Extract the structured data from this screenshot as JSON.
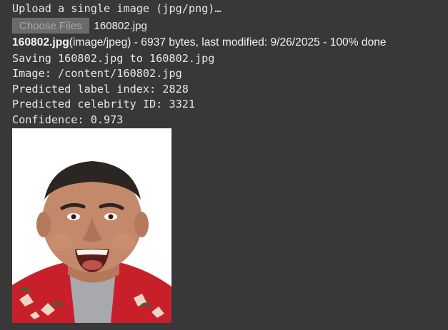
{
  "prompt": "Upload a single image (jpg/png)…",
  "upload": {
    "button_label": "Choose Files",
    "selected_file": "160802.jpg"
  },
  "file_info": {
    "name": "160802.jpg",
    "details": "(image/jpeg) - 6937 bytes, last modified: 9/26/2025 - 100% done"
  },
  "log_lines": [
    "Saving 160802.jpg to 160802.jpg",
    "Image: /content/160802.jpg",
    "Predicted label index: 2828",
    "Predicted celebrity ID: 3321",
    "Confidence: 0.973"
  ]
}
